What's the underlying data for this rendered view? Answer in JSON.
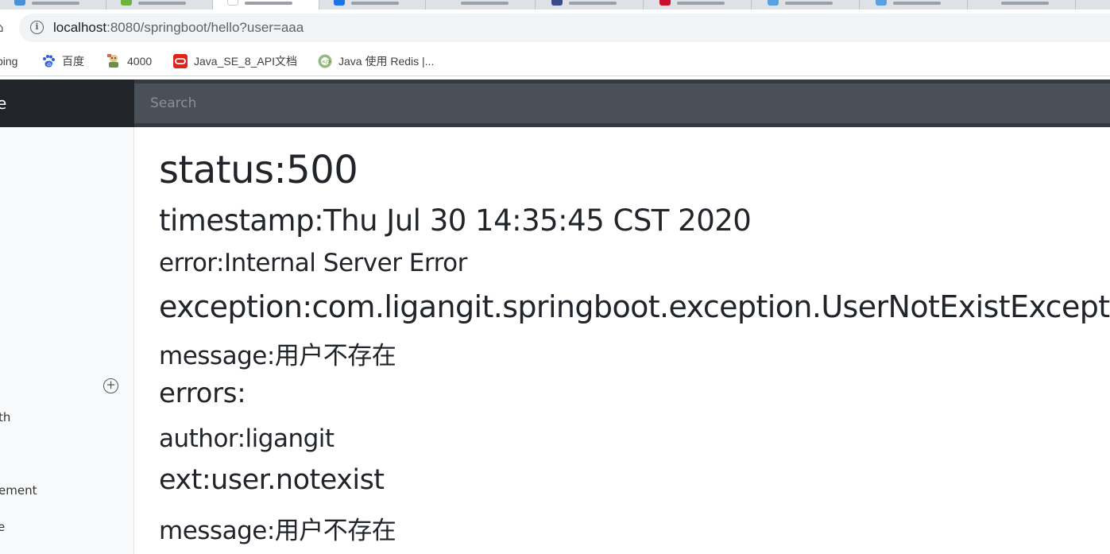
{
  "browser": {
    "url_host": "localhost",
    "url_path": ":8080/springboot/hello?user=aaa",
    "bookmarks": [
      {
        "label": "bing",
        "icon": "bing-icon"
      },
      {
        "label": "百度",
        "icon": "baidu-paw-icon"
      },
      {
        "label": "4000",
        "icon": "bookmark-favicon-icon"
      },
      {
        "label": "Java_SE_8_API文档",
        "icon": "oracle-icon"
      },
      {
        "label": "Java 使用 Redis |...",
        "icon": "runoob-icon"
      }
    ]
  },
  "header": {
    "brand": "e",
    "search_placeholder": "Search"
  },
  "sidebar": {
    "items": [
      "th",
      "ement",
      "e"
    ]
  },
  "error_page": {
    "status": "status:500",
    "timestamp": "timestamp:Thu Jul 30 14:35:45 CST 2020",
    "error": "error:Internal Server Error",
    "exception": "exception:com.ligangit.springboot.exception.UserNotExistException",
    "message": "message:用户不存在",
    "errors": "errors:",
    "author": "author:ligangit",
    "ext": "ext:user.notexist",
    "ext_message": "message:用户不存在"
  },
  "colors": {
    "header_bg": "#343a40",
    "brand_bg": "#212529",
    "search_bg": "#495057",
    "sidebar_bg": "#f8f9fa"
  }
}
